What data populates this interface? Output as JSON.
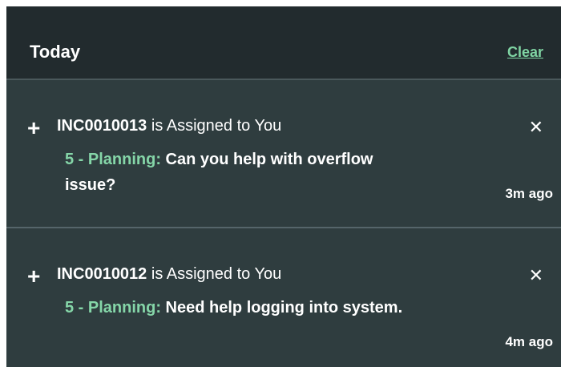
{
  "header": {
    "title": "Today",
    "clear_label": "Clear"
  },
  "notifications": [
    {
      "incident": "INC0010013",
      "headline_suffix": " is Assigned to You",
      "category": "5 - Planning:",
      "message": " Can you help with overflow issue?",
      "time": "3m ago"
    },
    {
      "incident": "INC0010012",
      "headline_suffix": " is Assigned to You",
      "category": "5 - Planning:",
      "message": " Need help logging into system.",
      "time": "4m ago"
    }
  ],
  "icons": {
    "expand": "plus-icon",
    "dismiss": "close-icon"
  },
  "colors": {
    "panel_bg": "#2f3d3f",
    "header_bg": "#222b2e",
    "accent": "#7fd4a3"
  }
}
